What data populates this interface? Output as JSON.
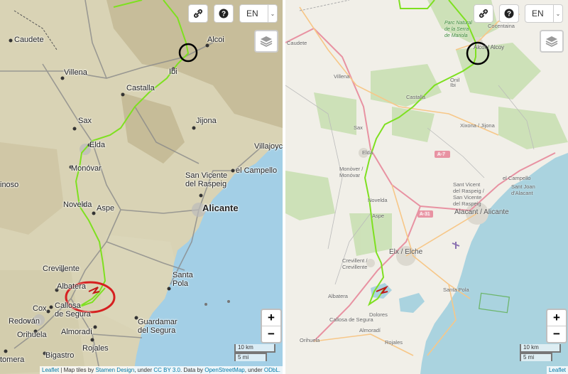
{
  "left_map": {
    "tiles": "stamen-terrain",
    "labels": {
      "caudete": "Caudete",
      "villena": "Villena",
      "ibi": "Ibi",
      "alcoi": "Alcoi",
      "castalla": "Castalla",
      "sax": "Sax",
      "jijona": "Jijona",
      "elda": "Elda",
      "villajoyosa": "Villajoyc",
      "monovar": "Monóvar",
      "san_vicente": "San Vicente\ndel Raspeig",
      "el_campello": "el Campello",
      "pinoso": "inoso",
      "novelda": "Novelda",
      "aspe": "Aspe",
      "alicante": "Alicante",
      "crevillente": "Crevillente",
      "santa_pola": "Santa\nPola",
      "albatera": "Albatera",
      "cox": "Cox",
      "callosa": "Callosa\nde Segura",
      "redovan": "Redován",
      "orihuela": "Orihuela",
      "almoradi": "Almoradí",
      "guardamar": "Guardamar\ndel Segura",
      "rojales": "Rojales",
      "bigastro": "Bigastro",
      "torremendo": "tomera"
    },
    "controls": {
      "link_icon": "link-icon",
      "help_icon": "question-icon",
      "language": "EN",
      "layers_icon": "layers-icon"
    },
    "zoom": {
      "in": "+",
      "out": "−"
    },
    "scale": {
      "km": "10 km",
      "mi": "5 mi"
    },
    "attribution": {
      "leaflet": "Leaflet",
      "sep": " | Map tiles by ",
      "stamen": "Stamen Design",
      "under1": ", under ",
      "cc": "CC BY 3.0",
      "data": ". Data by ",
      "osm": "OpenStreetMap",
      "under2": ", under ",
      "odbl": "ODbL."
    },
    "highlight_colors": {
      "track": "#7ee020",
      "start_circle": "#000000",
      "end_circle": "#d62020"
    }
  },
  "right_map": {
    "tiles": "openstreetmap",
    "labels": {
      "caudete": "Caudete",
      "villena": "Villena",
      "onil": "Onil",
      "ibi": "Ibi",
      "alcoi": "Alcoi / Alcoy",
      "cocentaina": "Cocentaina",
      "park": "Parc Natural\nde la Serra\nde Mariola",
      "castalla": "Castalla",
      "sax": "Sax",
      "xixona": "Xixona / Jijona",
      "elda": "Elda",
      "a7": "A-7",
      "monover": "Monòver /\nMonóvar",
      "el_campello": "el Campello",
      "san_vicente": "Sant Vicent\ndel Raspeig /\nSan Vicente\ndel Raspeig",
      "sant_joan": "Sant Joan\nd'Alacant",
      "novelda": "Novelda",
      "alacant": "Alacant / Alicante",
      "aspe": "Aspe",
      "a31": "A-31",
      "elx": "Elx / Elche",
      "crevillent": "Crevillent /\nCrevillente",
      "albatera": "Albatera",
      "santa_pola": "Santa Pola",
      "dolores": "Dolores",
      "callosa": "Callosa de Segura",
      "almoradi": "Almoradí",
      "orihuela": "Orihuela",
      "rojales": "Rojales"
    },
    "controls": {
      "link_icon": "link-icon",
      "help_icon": "question-icon",
      "language": "EN",
      "layers_icon": "layers-icon"
    },
    "zoom": {
      "in": "+",
      "out": "−"
    },
    "scale": {
      "km": "10 km",
      "mi": "5 mi"
    },
    "attribution": {
      "leaflet": "Leaflet"
    }
  }
}
